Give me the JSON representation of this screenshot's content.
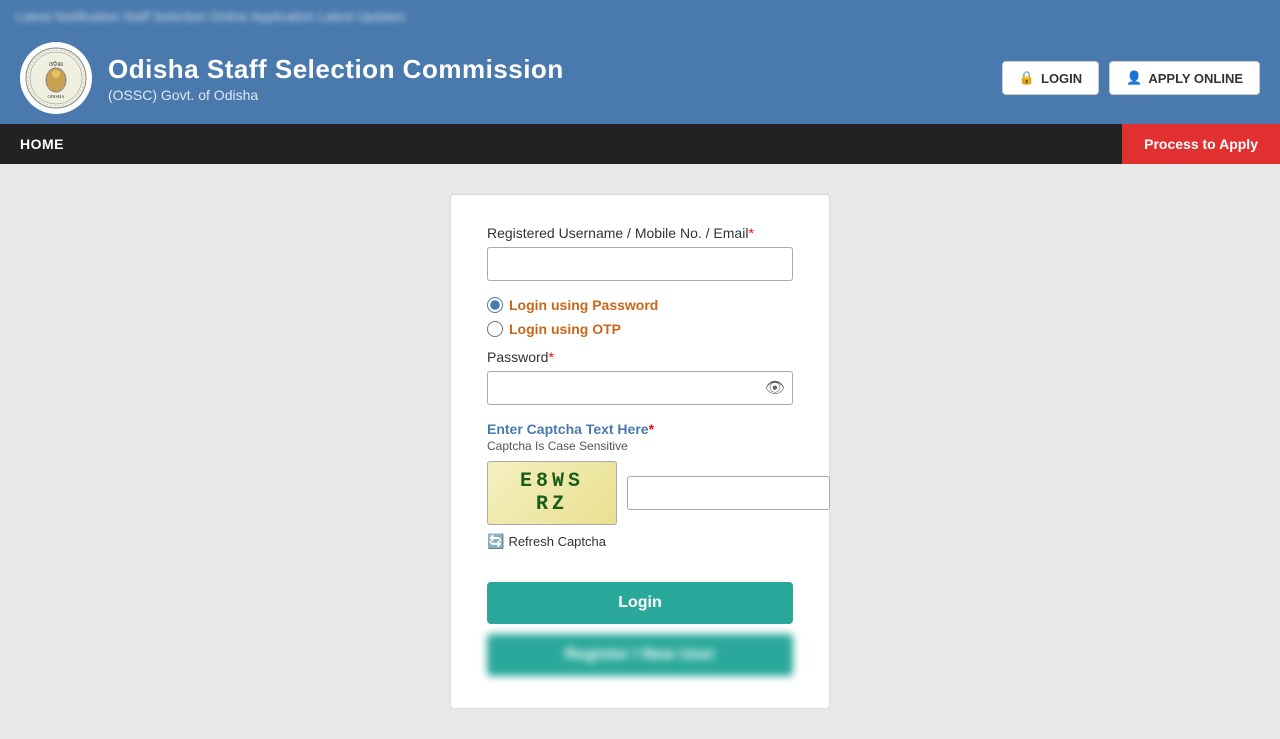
{
  "ticker": {
    "text": "Latest Notification   Staff Selection   Online Application   Latest Updates"
  },
  "header": {
    "org_name": "Odisha Staff Selection Commission",
    "org_sub": "(OSSC) Govt. of Odisha",
    "login_btn": "LOGIN",
    "apply_btn": "APPLY ONLINE"
  },
  "nav": {
    "home": "HOME",
    "process_to_apply": "Process to Apply"
  },
  "login_form": {
    "username_label": "Registered Username / Mobile No. / Email",
    "username_placeholder": "",
    "radio_password_label": "Login using Password",
    "radio_otp_label": "Login using OTP",
    "password_label": "Password",
    "captcha_label": "Enter Captcha Text Here",
    "captcha_sensitive": "Captcha Is Case Sensitive",
    "captcha_value": "E8WS RZ",
    "refresh_captcha": "Refresh Captcha",
    "login_btn": "Login",
    "bottom_btn": "Register / New User"
  }
}
